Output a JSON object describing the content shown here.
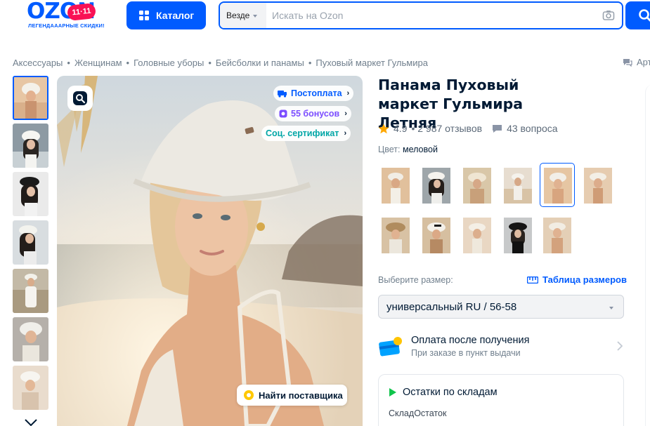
{
  "header": {
    "logo_text": "OZON",
    "logo_badge": "11·11",
    "logo_subtitle": "ЛЕГЕНДАААРНЫЕ СКИДКИ!",
    "catalog_label": "Каталог",
    "search_scope": "Везде",
    "search_placeholder": "Искать на Ozon"
  },
  "breadcrumb": {
    "items": [
      "Аксессуары",
      "Женщинам",
      "Головные уборы",
      "Бейсболки и панамы",
      "Пуховый маркет Гульмира"
    ],
    "separator": "•",
    "right_label": "Арт"
  },
  "gallery": {
    "badges": {
      "postpay": "Постоплата",
      "bonus": "55 бонусов",
      "certificate": "Соц. сертификат"
    },
    "find_supplier": "Найти поставщика"
  },
  "product": {
    "title": "Панама Пуховый маркет Гульмира Летняя",
    "rating": "4.9",
    "reviews": "• 2 987 отзывов",
    "questions": "43 вопроса",
    "color_label": "Цвет:",
    "color_value": "меловой"
  },
  "size": {
    "label": "Выберите размер:",
    "table_link": "Таблица размеров",
    "selected": "универсальный RU / 56-58"
  },
  "payment": {
    "title": "Оплата после получения",
    "subtitle": "При заказе в пункт выдачи"
  },
  "stock": {
    "title": "Остатки по складам",
    "column_warehouse": "Склад",
    "column_stock": "Остаток"
  },
  "colors": {
    "brand_blue": "#005bff",
    "pink_badge": "#f91155",
    "bonus_purple": "#7b4dff",
    "certificate_teal": "#00a6a6",
    "star": "#ffa800"
  }
}
